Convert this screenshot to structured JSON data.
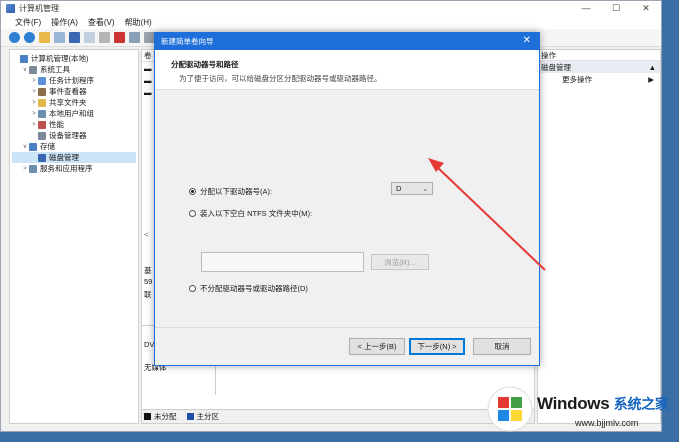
{
  "window": {
    "title": "计算机管理",
    "controls": [
      "—",
      "☐",
      "✕"
    ]
  },
  "menu": [
    "文件(F)",
    "操作(A)",
    "查看(V)",
    "帮助(H)"
  ],
  "tree": [
    {
      "label": "计算机管理(本地)",
      "indent": 0,
      "arrow": ""
    },
    {
      "label": "系统工具",
      "indent": 1,
      "arrow": "∨"
    },
    {
      "label": "任务计划程序",
      "indent": 2,
      "arrow": ">"
    },
    {
      "label": "事件查看器",
      "indent": 2,
      "arrow": ">"
    },
    {
      "label": "共享文件夹",
      "indent": 2,
      "arrow": ">"
    },
    {
      "label": "本地用户和组",
      "indent": 2,
      "arrow": ">"
    },
    {
      "label": "性能",
      "indent": 2,
      "arrow": ">"
    },
    {
      "label": "设备管理器",
      "indent": 2,
      "arrow": ""
    },
    {
      "label": "存储",
      "indent": 1,
      "arrow": "∨"
    },
    {
      "label": "磁盘管理",
      "indent": 2,
      "arrow": "",
      "selected": true
    },
    {
      "label": "服务和应用程序",
      "indent": 1,
      "arrow": ">"
    }
  ],
  "center": {
    "col_header": "卷",
    "fragments": [
      "基",
      "59",
      "联",
      "DV",
      "无媒体"
    ]
  },
  "legend": [
    {
      "label": "未分配",
      "color": "#111111"
    },
    {
      "label": "主分区",
      "color": "#1f4fa8"
    }
  ],
  "actions": {
    "header": "操作",
    "section": "磁盘管理",
    "section_arrow": "▲",
    "items": [
      {
        "label": "更多操作",
        "arrow": "▶"
      }
    ]
  },
  "dialog": {
    "title": "新建简单卷向导",
    "close": "✕",
    "heading": "分配驱动器号和路径",
    "subheading": "为了便于访问，可以给磁盘分区分配驱动器号或驱动器路径。",
    "options": [
      {
        "label": "分配以下驱动器号(A):",
        "checked": true
      },
      {
        "label": "装入以下空白 NTFS 文件夹中(M):",
        "checked": false
      },
      {
        "label": "不分配驱动器号或驱动器路径(D)",
        "checked": false
      }
    ],
    "drive_letter": "D",
    "browse_label": "浏览(R)...",
    "buttons": {
      "back": "< 上一步(B)",
      "next": "下一步(N) >",
      "cancel": "取消"
    }
  },
  "logo": {
    "brand": "Windows",
    "brand_zh": "系统之家",
    "url": "www.bjjmlv.com"
  },
  "colors": {
    "accent": "#1e6fd9",
    "arrow": "#e53935"
  }
}
